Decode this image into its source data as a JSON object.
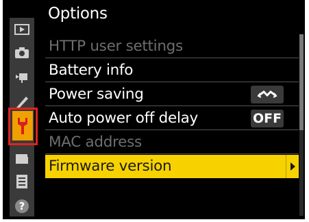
{
  "menu_title": "Options",
  "sidebar": [
    {
      "icon": "playback-icon"
    },
    {
      "icon": "camera-icon"
    },
    {
      "icon": "movie-icon"
    },
    {
      "icon": "pencil-icon"
    },
    {
      "icon": "wrench-icon",
      "active": true
    },
    {
      "icon": "retouch-icon"
    },
    {
      "icon": "my-menu-icon"
    },
    {
      "icon": "help-icon",
      "label": "?"
    }
  ],
  "items": [
    {
      "label": "HTTP user settings",
      "state": "disabled"
    },
    {
      "label": "Battery info",
      "state": "normal"
    },
    {
      "label": "Power saving",
      "state": "normal",
      "value_icon": "power-saving-icon"
    },
    {
      "label": "Auto power off delay",
      "state": "normal",
      "value": "OFF"
    },
    {
      "label": "MAC address",
      "state": "disabled"
    },
    {
      "label": "Firmware version",
      "state": "selected"
    }
  ],
  "colors": {
    "selected_row": "#f7d200",
    "active_tab": "#f0a100",
    "highlight_border": "#e0231f"
  }
}
